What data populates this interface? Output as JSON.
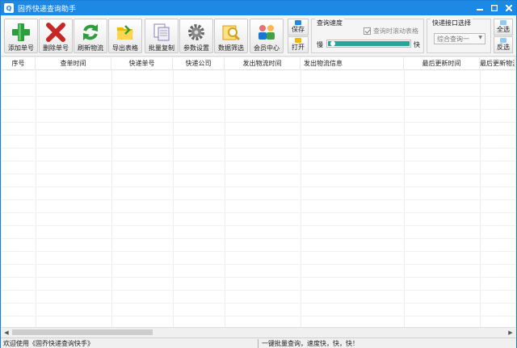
{
  "window": {
    "title": "固乔快递查询助手"
  },
  "toolbar": {
    "buttons": [
      {
        "label": "添加单号",
        "icon": "plus-icon"
      },
      {
        "label": "删除单号",
        "icon": "delete-x-icon"
      },
      {
        "label": "刷新物流",
        "icon": "refresh-icon"
      },
      {
        "label": "导出表格",
        "icon": "export-folder-icon"
      },
      {
        "label": "批量复制",
        "icon": "copy-icon"
      },
      {
        "label": "参数设置",
        "icon": "gear-icon"
      },
      {
        "label": "数据筛选",
        "icon": "filter-search-icon"
      },
      {
        "label": "会员中心",
        "icon": "member-icon"
      }
    ],
    "save_label": "保存",
    "open_label": "打开"
  },
  "speed": {
    "group_title": "查询速度",
    "scroll_checkbox_label": "查询时滚动表格",
    "slow_label": "慢",
    "fast_label": "快",
    "scroll_checked": true
  },
  "api": {
    "group_title": "快递接口选择",
    "selected": "综合查询一",
    "select_all_label": "全选",
    "invert_label": "反选"
  },
  "table": {
    "columns": [
      "序号",
      "查单时间",
      "快递单号",
      "快递公司",
      "发出物流时间",
      "发出物流信息",
      "最后更新时间",
      "最后更新物流"
    ]
  },
  "status": {
    "left": "欢迎使用《固乔快递查询快手》",
    "right": "一键批量查询，速度快，快，快！"
  },
  "colors": {
    "titlebar": "#1e88e5",
    "progress": "#26a69a"
  }
}
